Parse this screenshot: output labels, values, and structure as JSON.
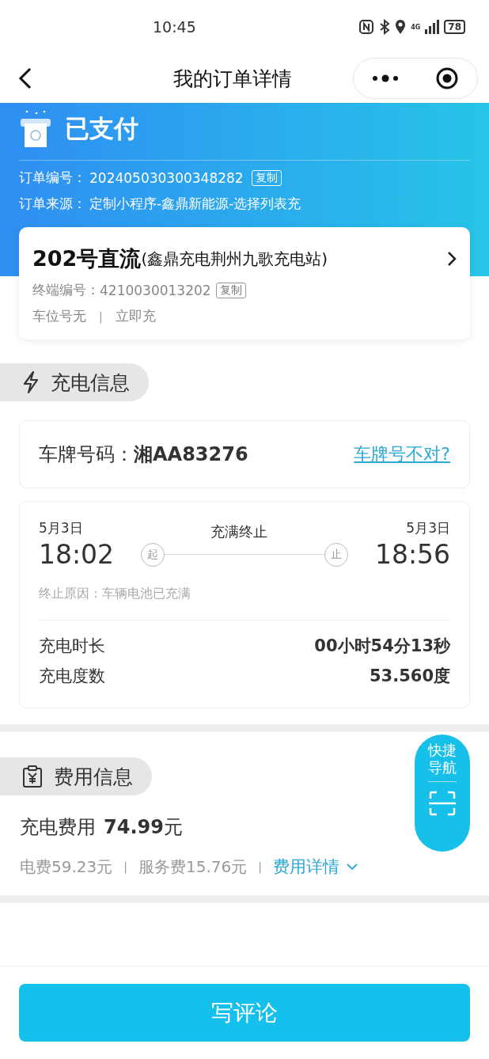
{
  "status_bar": {
    "time": "10:45",
    "network": "4G",
    "battery": "78"
  },
  "nav": {
    "title": "我的订单详情"
  },
  "header": {
    "status": "已支付",
    "order_no_label": "订单编号：",
    "order_no": "202405030300348282",
    "copy": "复制",
    "source_label": "订单来源：",
    "source": "定制小程序-鑫鼎新能源-选择列表充"
  },
  "station": {
    "name": "202号直流",
    "location": "(鑫鼎充电荆州九歌充电站)",
    "terminal_label": "终端编号：",
    "terminal_no": "4210030013202",
    "copy": "复制",
    "parking": "车位号无",
    "separator": "|",
    "mode": "立即充"
  },
  "charge_section": {
    "title": "充电信息"
  },
  "plate": {
    "label": "车牌号码：",
    "value": "湘AA83276",
    "link": "车牌号不对?"
  },
  "session": {
    "start_date": "5月3日",
    "start_time": "18:02",
    "start_mark": "起",
    "status": "充满终止",
    "end_mark": "止",
    "end_date": "5月3日",
    "end_time": "18:56",
    "reason": "终止原因：车辆电池已充满",
    "stats": [
      {
        "label": "充电时长",
        "value": "00小时54分13秒"
      },
      {
        "label": "充电度数",
        "value": "53.560度"
      }
    ]
  },
  "quick_nav": {
    "label": "快捷导航"
  },
  "fee_section": {
    "title": "费用信息"
  },
  "fee": {
    "label": "充电费用",
    "amount": "74.99",
    "unit": "元",
    "items": [
      {
        "text": "电费59.23元"
      },
      {
        "text": "服务费15.76元"
      }
    ],
    "separator": "|",
    "details": "费用详情"
  },
  "footer": {
    "button": "写评论"
  }
}
